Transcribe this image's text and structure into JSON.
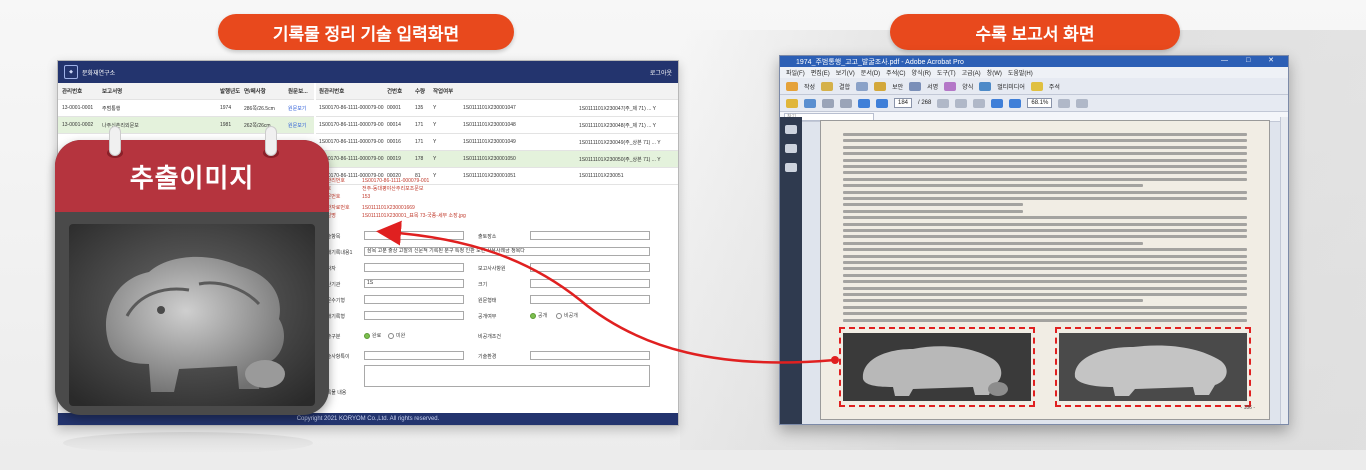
{
  "labels": {
    "left": "기록물 정리 기술 입력화면",
    "right": "수록 보고서 화면",
    "calendar": "추출이미지"
  },
  "app": {
    "title": "문화재연구소",
    "logout": "로그아웃",
    "footer": "Copyright 2021 KORYOM Co.,Ltd. All rights reserved.",
    "left_table": {
      "headers": [
        "관리번호",
        "보고서명",
        "발행년도",
        "면/페사항",
        "원문보..."
      ],
      "rows": [
        [
          "13-0001-0001",
          "주범통행",
          "1974",
          "286쪽/26.5cm",
          "원문보기"
        ],
        [
          "13-0001-0002",
          "나주신촌리외문보",
          "1981",
          "262쪽/26cm",
          "원문보기"
        ]
      ]
    },
    "right_table": {
      "headers": [
        "원관리번호",
        "건번호",
        "수량",
        "작업여부",
        "",
        ""
      ],
      "rows": [
        [
          "1S00170-86-1111-000079-001",
          "00001",
          "135",
          "Y",
          "1S0111101X230001047",
          "1S0111101X230047(주_제 71) ...   Y"
        ],
        [
          "1S00170-86-1111-000079-001",
          "00014",
          "171",
          "Y",
          "1S0111101X230001048",
          "1S0111101X230048(주_제 71) ...   Y"
        ],
        [
          "1S00170-86-1111-000079-001",
          "00016",
          "171",
          "Y",
          "1S0111101X230001049",
          "1S0111101X230049(주_상본 71) ...   Y"
        ],
        [
          "1S00170-86-1111-000079-001",
          "00019",
          "178",
          "Y",
          "1S0111101X230001050",
          "1S0111101X230050(주_상본 71) ...   Y"
        ],
        [
          "1S00170-86-1111-000079-001",
          "00020",
          "81",
          "Y",
          "1S0111101X230001051",
          "1S0111101X230051"
        ]
      ]
    },
    "form": {
      "info": [
        [
          "원관리번호",
          "1S00170-86-1111-000079-001"
        ],
        [
          "권호",
          "전주-동대평야산주리포조문보"
        ],
        [
          "원문번호",
          "153"
        ],
        [
          "이관자료번호",
          "1S0111101X230001669"
        ],
        [
          "파일명",
          "1S0111101X230001_표목 73-국종-세부 소장.jpg"
        ]
      ],
      "field_labels": {
        "title": "기술항목",
        "place": "출토장소",
        "desc": "원래기록내용1",
        "author": "원작자",
        "period": "보고사사항원",
        "date": "생산기관",
        "size": "크기",
        "lang": "원문수기형",
        "form2": "원문형태",
        "media": "원래기록형",
        "status": "공개여부",
        "open_status": "공개",
        "closed": "비공개",
        "extract": "추출구분",
        "yes": "완료",
        "no": "미완",
        "remark": "비공개조건",
        "etc": "기술사항특이",
        "etc2": "기술환경",
        "record": "기록물 내용",
        "reg1": "주요어명칭",
        "reg2": "주요어분류",
        "save": "소장처 정보",
        "other": "기타 정보"
      },
      "desc_value": "삼목 고분 출상 고찰의 신문적 기록된 분구 특정 인판 도면 사용사례금 정복다",
      "author_value": "1S"
    }
  },
  "pdf": {
    "title": "1974_주범통행_고고_발굴조사.pdf - Adobe Acrobat Pro",
    "window_controls": "—  □  ✕",
    "menu": [
      "파일(F)",
      "편집(E)",
      "보기(V)",
      "문서(D)",
      "주석(C)",
      "양식(R)",
      "도구(T)",
      "고급(A)",
      "창(W)",
      "도움말(H)"
    ],
    "toolbar": [
      "작성",
      "결합",
      "",
      "보안",
      "서명",
      "양식",
      "멀티미디어",
      "주석"
    ],
    "page_current": "184",
    "page_total": "/ 268",
    "zoom": "68.1%",
    "search_placeholder": "찾기",
    "page_number": "- 186 -"
  }
}
